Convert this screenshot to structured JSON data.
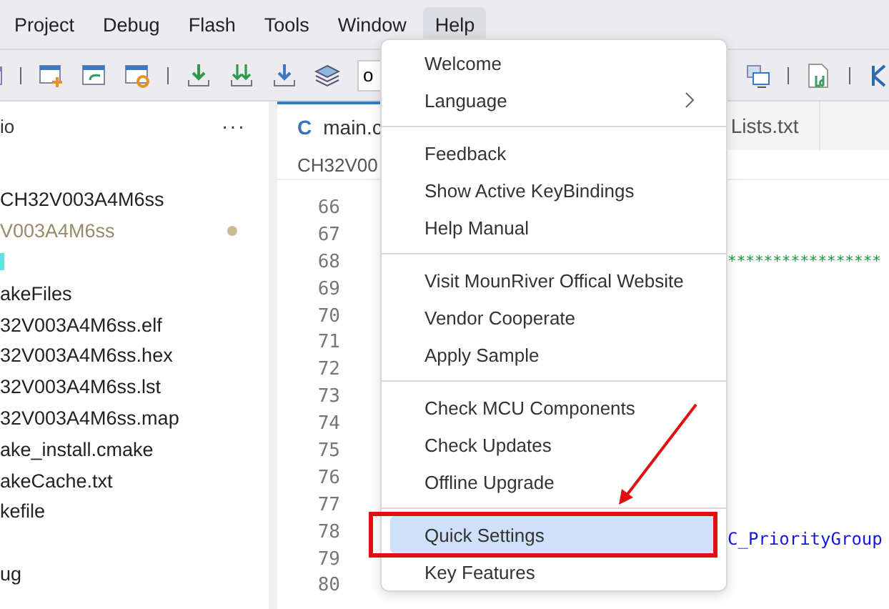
{
  "menubar": [
    {
      "label": "Project",
      "selected": false
    },
    {
      "label": "Debug",
      "selected": false
    },
    {
      "label": "Flash",
      "selected": false
    },
    {
      "label": "Tools",
      "selected": false
    },
    {
      "label": "Window",
      "selected": false
    },
    {
      "label": "Help",
      "selected": true
    }
  ],
  "toolbar": {
    "field": {
      "value": "o"
    }
  },
  "explorer": {
    "title": "io",
    "more": "···",
    "rows": [
      {
        "kind": "text",
        "label": "CH32V003A4M6ss",
        "modified": false
      },
      {
        "kind": "text",
        "label": "V003A4M6ss",
        "modified": true
      },
      {
        "kind": "icon"
      },
      {
        "kind": "text",
        "label": "akeFiles",
        "modified": false
      },
      {
        "kind": "text",
        "label": "32V003A4M6ss.elf",
        "modified": false
      },
      {
        "kind": "text",
        "label": "32V003A4M6ss.hex",
        "modified": false
      },
      {
        "kind": "text",
        "label": "32V003A4M6ss.lst",
        "modified": false
      },
      {
        "kind": "text",
        "label": "32V003A4M6ss.map",
        "modified": false
      },
      {
        "kind": "text",
        "label": "ake_install.cmake",
        "modified": false
      },
      {
        "kind": "text",
        "label": "akeCache.txt",
        "modified": false
      },
      {
        "kind": "text",
        "label": "kefile",
        "modified": false
      },
      {
        "kind": "blank"
      },
      {
        "kind": "text",
        "label": "ug",
        "modified": false
      }
    ]
  },
  "editor": {
    "tabs": [
      {
        "icon": "C",
        "label": "main.c",
        "selected": true
      },
      {
        "label": "Lists.txt",
        "selected": false
      }
    ],
    "breadcrumb": "CH32V00",
    "lines": [
      {
        "number": "66"
      },
      {
        "number": "67"
      },
      {
        "number": "68",
        "kind": "comment",
        "text": "*****************"
      },
      {
        "number": "69"
      },
      {
        "number": "70"
      },
      {
        "number": "71"
      },
      {
        "number": "72"
      },
      {
        "number": "73"
      },
      {
        "number": "74"
      },
      {
        "number": "75"
      },
      {
        "number": "76"
      },
      {
        "number": "77"
      },
      {
        "number": "78",
        "kind": "code",
        "text": "C_PriorityGroup"
      },
      {
        "number": "79"
      },
      {
        "number": "80"
      }
    ]
  },
  "help_menu": {
    "groups": [
      [
        {
          "label": "Welcome",
          "submenu": false,
          "selected": false
        },
        {
          "label": "Language",
          "submenu": true,
          "selected": false
        }
      ],
      [
        {
          "label": "Feedback",
          "submenu": false,
          "selected": false
        },
        {
          "label": "Show Active KeyBindings",
          "submenu": false,
          "selected": false
        },
        {
          "label": "Help Manual",
          "submenu": false,
          "selected": false
        }
      ],
      [
        {
          "label": "Visit MounRiver Offical Website",
          "submenu": false,
          "selected": false
        },
        {
          "label": "Vendor Cooperate",
          "submenu": false,
          "selected": false
        },
        {
          "label": "Apply Sample",
          "submenu": false,
          "selected": false
        }
      ],
      [
        {
          "label": "Check MCU Components",
          "submenu": false,
          "selected": false
        },
        {
          "label": "Check Updates",
          "submenu": false,
          "selected": false
        },
        {
          "label": "Offline Upgrade",
          "submenu": false,
          "selected": false
        }
      ],
      [
        {
          "label": "Quick Settings",
          "submenu": false,
          "selected": true
        },
        {
          "label": "Key Features",
          "submenu": false,
          "selected": false
        }
      ]
    ]
  }
}
